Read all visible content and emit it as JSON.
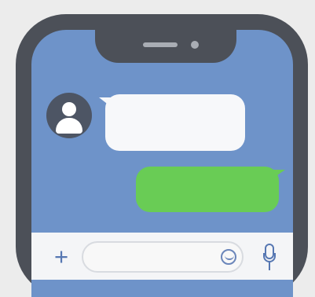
{
  "chat": {
    "incoming_message": "",
    "outgoing_message": ""
  },
  "composer": {
    "input_value": "",
    "input_placeholder": ""
  },
  "icons": {
    "avatar": "user-icon",
    "add": "plus-icon",
    "emoji": "smiley-icon",
    "voice": "microphone-icon"
  },
  "colors": {
    "frame": "#4c5058",
    "screen_background": "#6e93c9",
    "incoming_bubble": "#f7f8fa",
    "outgoing_bubble": "#69cc55",
    "accent": "#5677b2"
  }
}
